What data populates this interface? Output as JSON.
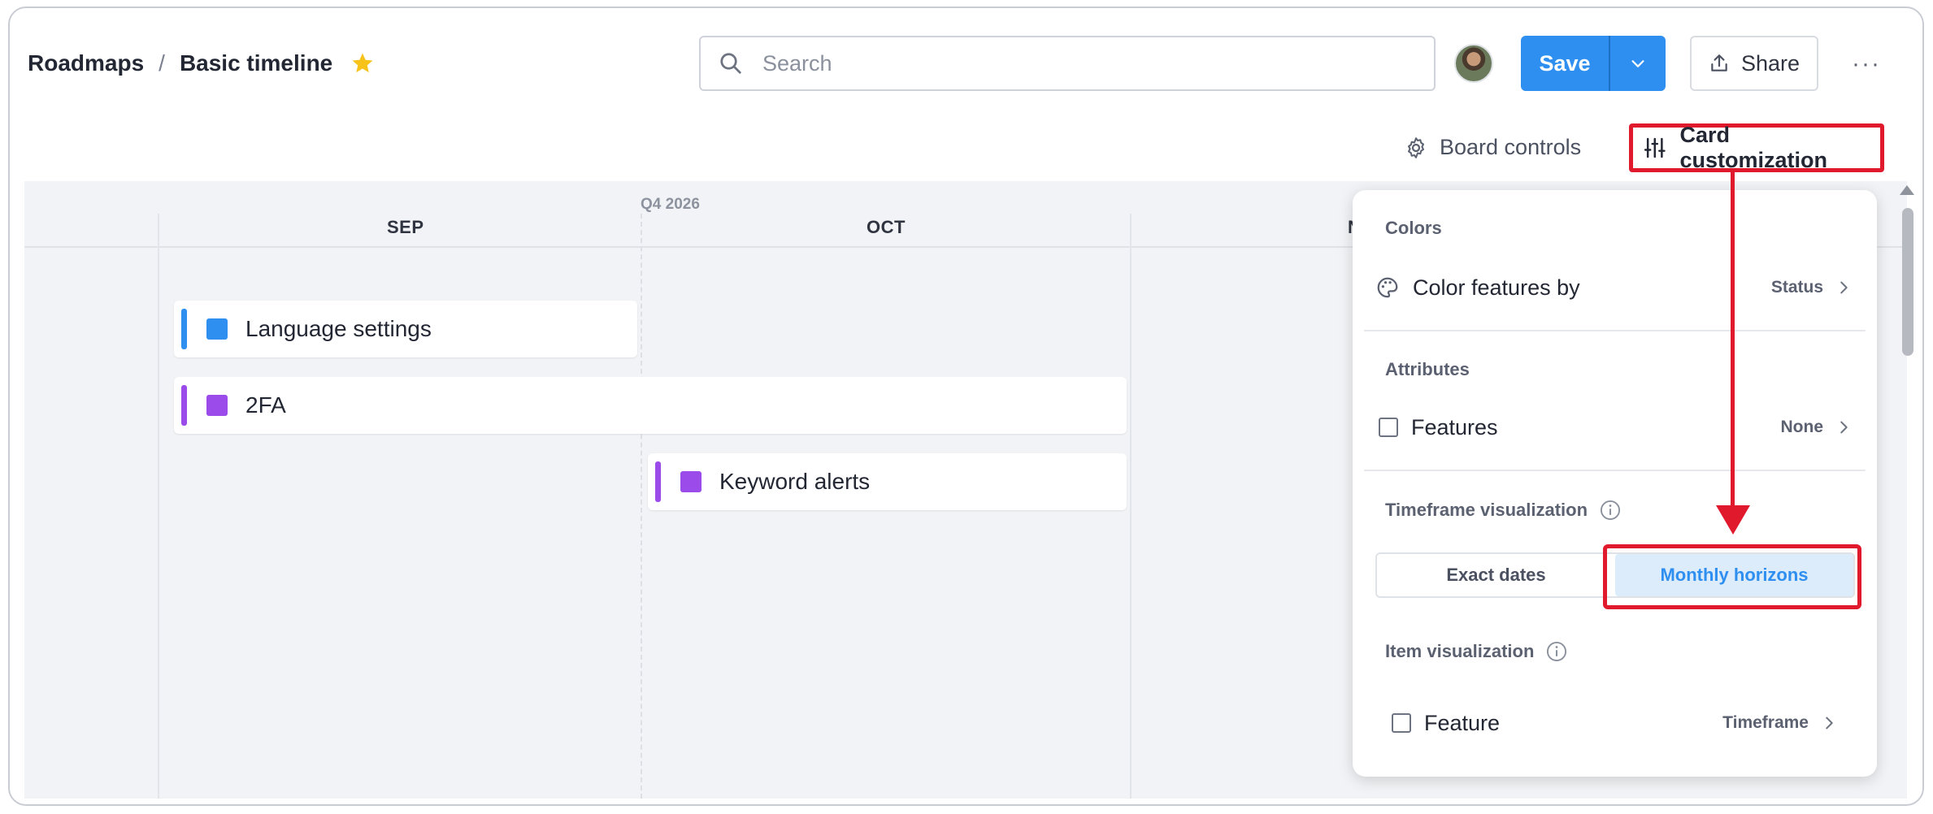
{
  "header": {
    "breadcrumb_root": "Roadmaps",
    "breadcrumb_sep": "/",
    "breadcrumb_current": "Basic timeline",
    "star_icon": "star-icon",
    "search_placeholder": "Search",
    "save_label": "Save",
    "share_label": "Share",
    "more_label": "···"
  },
  "toolbar": {
    "board_controls_label": "Board controls",
    "card_customization_label": "Card customization"
  },
  "timeline": {
    "quarter_label": "Q4 2026",
    "months": [
      "SEP",
      "OCT",
      "N"
    ],
    "cards": [
      {
        "name": "Language settings",
        "color": "#2e8ff0"
      },
      {
        "name": "2FA",
        "color": "#9b4bea"
      },
      {
        "name": "Keyword alerts",
        "color": "#9b4bea"
      }
    ]
  },
  "panel": {
    "colors_title": "Colors",
    "color_features_label": "Color features by",
    "color_features_value": "Status",
    "attributes_title": "Attributes",
    "features_label": "Features",
    "features_value": "None",
    "timeframe_title": "Timeframe visualization",
    "exact_dates_label": "Exact dates",
    "monthly_horizons_label": "Monthly horizons",
    "item_vis_title": "Item visualization",
    "feature_label": "Feature",
    "feature_value": "Timeframe"
  },
  "colors": {
    "accent": "#2e8ff0",
    "highlight": "#e0192c",
    "purple": "#9b4bea",
    "star": "#f7c31a"
  }
}
